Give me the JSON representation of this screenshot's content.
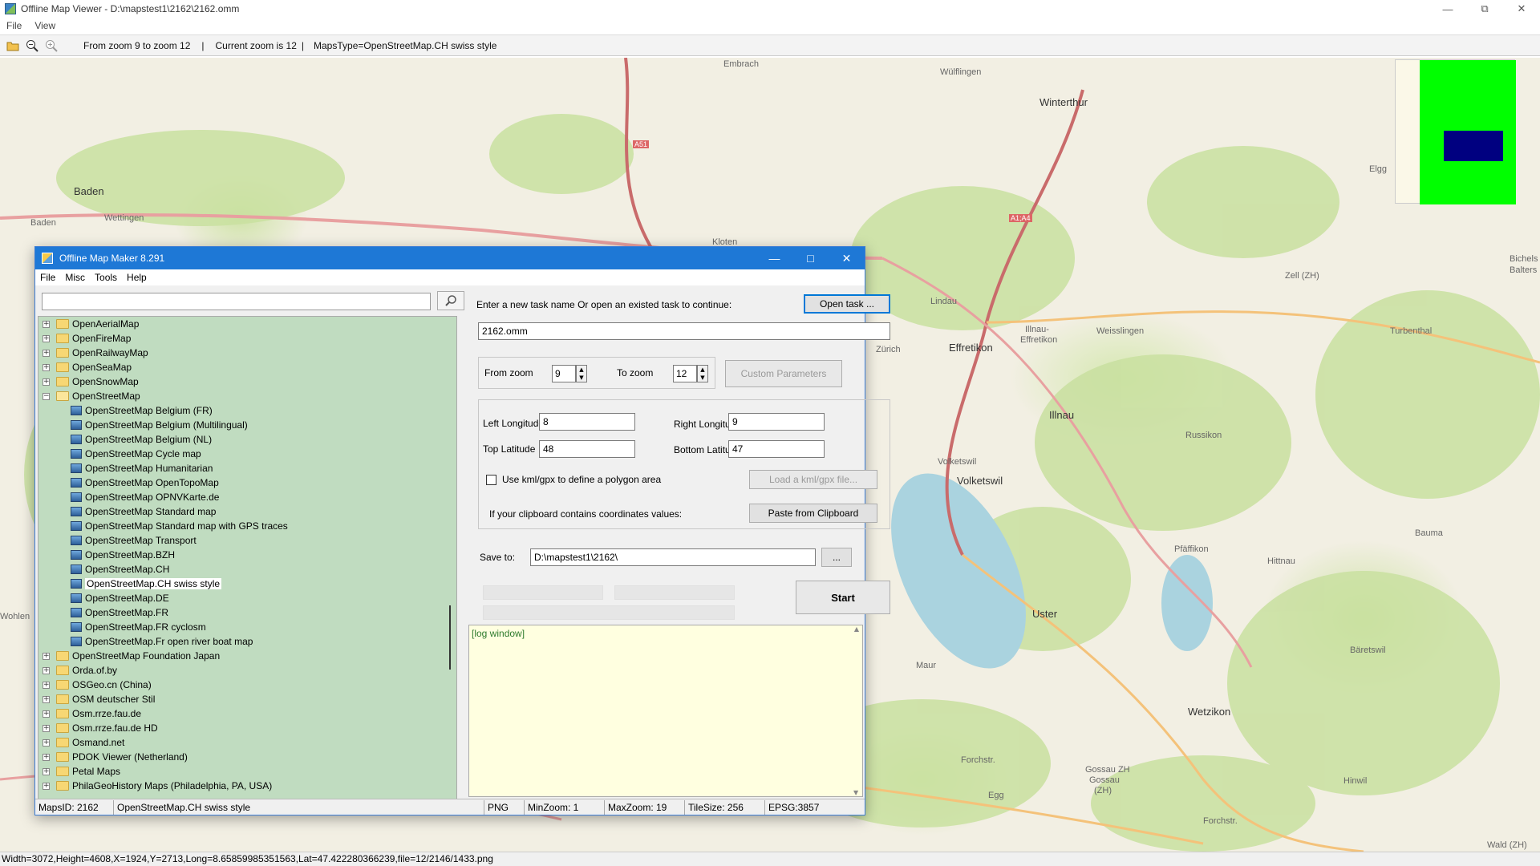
{
  "viewer": {
    "title": "Offline Map Viewer - D:\\mapstest1\\2162\\2162.omm",
    "menu": [
      "File",
      "View"
    ],
    "toolbar": {
      "zoom_range": "From zoom 9 to zoom 12",
      "current_zoom": "Current zoom is 12",
      "maps_type": "MapsType=OpenStreetMap.CH swiss style"
    },
    "status": "Width=3072,Height=4608,X=1924,Y=2713,Long=8.65859985351563,Lat=47.422280366239,file=12/2146/1433.png"
  },
  "map": {
    "labels": [
      "Embrach",
      "Wülflingen",
      "Winterthur",
      "A51",
      "Baden",
      "Baden",
      "Wettingen",
      "Kloten",
      "A1;A4",
      "Elgg",
      "Bichels",
      "Balters",
      "Zell (ZH)",
      "Lindau",
      "Illnau-",
      "Effretikon",
      "Weisslingen",
      "Turbenthal",
      "Zürich",
      "Effretikon",
      "Illnau",
      "Russikon",
      "Volketswil",
      "Volketswil",
      "Pfäffikon",
      "Hittnau",
      "Bauma",
      "Wohlen",
      "Uster",
      "Maur",
      "Bäretswil",
      "Wetzikon",
      "Gossau ZH",
      "Gossau",
      "(ZH)",
      "Forchstr.",
      "Egg",
      "Hinwil",
      "Forchstr.",
      "Wald (ZH)"
    ]
  },
  "dialog": {
    "title": "Offline Map Maker 8.291",
    "menu": [
      "File",
      "Misc",
      "Tools",
      "Help"
    ],
    "search_placeholder": "",
    "tree": {
      "folders_before": [
        "OpenAerialMap",
        "OpenFireMap",
        "OpenRailwayMap",
        "OpenSeaMap",
        "OpenSnowMap"
      ],
      "open_folder": "OpenStreetMap",
      "children": [
        "OpenStreetMap Belgium (FR)",
        "OpenStreetMap Belgium (Multilingual)",
        "OpenStreetMap Belgium (NL)",
        "OpenStreetMap Cycle map",
        "OpenStreetMap Humanitarian",
        "OpenStreetMap OpenTopoMap",
        "OpenStreetMap OPNVKarte.de",
        "OpenStreetMap Standard map",
        "OpenStreetMap Standard map with GPS traces",
        "OpenStreetMap Transport",
        "OpenStreetMap.BZH",
        "OpenStreetMap.CH",
        "OpenStreetMap.CH swiss style",
        "OpenStreetMap.DE",
        "OpenStreetMap.FR",
        "OpenStreetMap.FR cyclosm",
        "OpenStreetMap.Fr open river boat map"
      ],
      "selected": "OpenStreetMap.CH swiss style",
      "folders_after": [
        "OpenStreetMap Foundation Japan",
        "Orda.of.by",
        "OSGeo.cn (China)",
        "OSM deutscher Stil",
        "Osm.rrze.fau.de",
        "Osm.rrze.fau.de HD",
        "Osmand.net",
        "PDOK Viewer (Netherland)",
        "Petal Maps",
        "PhilaGeoHistory Maps (Philadelphia, PA, USA)"
      ]
    },
    "task_prompt": "Enter a new task name Or open an existed task to continue:",
    "open_task_label": "Open task ...",
    "task_name": "2162.omm",
    "from_zoom_label": "From zoom",
    "from_zoom": "9",
    "to_zoom_label": "To zoom",
    "to_zoom": "12",
    "custom_params_label": "Custom Parameters",
    "left_lon_label": "Left Longitude",
    "left_lon": "8",
    "right_lon_label": "Right Longitude",
    "right_lon": "9",
    "top_lat_label": "Top Latitude",
    "top_lat": "48",
    "bottom_lat_label": "Bottom Latitude",
    "bottom_lat": "47",
    "kml_checkbox_label": "Use kml/gpx to define a polygon area",
    "load_kml_label": "Load a kml/gpx file...",
    "clipboard_prompt": "If your clipboard contains coordinates values:",
    "paste_label": "Paste from Clipboard",
    "save_to_label": "Save to:",
    "save_to": "D:\\mapstest1\\2162\\",
    "browse_label": "...",
    "start_label": "Start",
    "log_text": "[log window]",
    "status": {
      "maps_id": "MapsID: 2162",
      "maps_name": "OpenStreetMap.CH swiss style",
      "format": "PNG",
      "min_zoom": "MinZoom: 1",
      "max_zoom": "MaxZoom: 19",
      "tile_size": "TileSize: 256",
      "epsg": "EPSG:3857"
    }
  },
  "colors": {
    "dialog_titlebar": "#1e78d6",
    "tree_background": "#c0dcc0",
    "log_background": "#ffffe0",
    "overview_green": "#00ff00",
    "overview_box": "#000080"
  }
}
